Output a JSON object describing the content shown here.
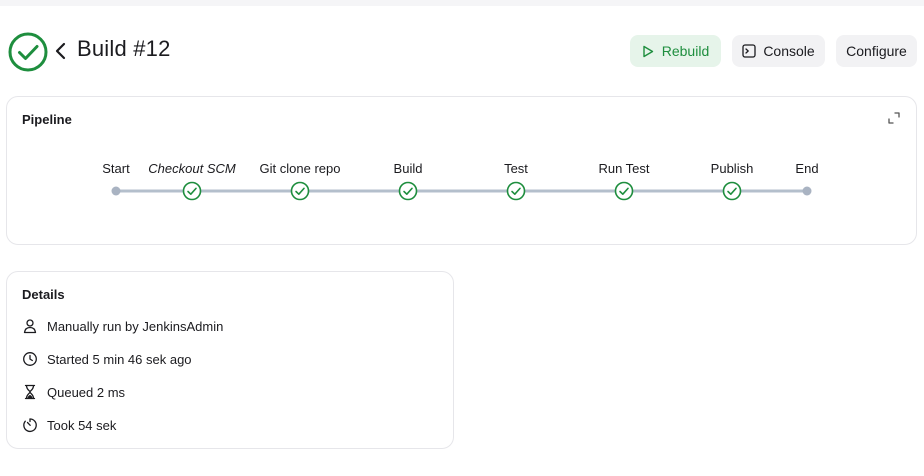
{
  "header": {
    "title": "Build #12",
    "buttons": {
      "rebuild": "Rebuild",
      "console": "Console",
      "configure": "Configure"
    },
    "status": "success"
  },
  "pipeline": {
    "title": "Pipeline",
    "stages": [
      {
        "label": "Start",
        "kind": "start",
        "italic": false
      },
      {
        "label": "Checkout SCM",
        "kind": "success",
        "italic": true
      },
      {
        "label": "Git clone repo",
        "kind": "success",
        "italic": false
      },
      {
        "label": "Build",
        "kind": "success",
        "italic": false
      },
      {
        "label": "Test",
        "kind": "success",
        "italic": false
      },
      {
        "label": "Run Test",
        "kind": "success",
        "italic": false
      },
      {
        "label": "Publish",
        "kind": "success",
        "italic": false
      },
      {
        "label": "End",
        "kind": "end",
        "italic": false
      }
    ]
  },
  "details": {
    "title": "Details",
    "items": [
      {
        "icon": "user-icon",
        "text": "Manually run by JenkinsAdmin"
      },
      {
        "icon": "clock-icon",
        "text": "Started 5 min 46 sek ago"
      },
      {
        "icon": "hourglass-icon",
        "text": "Queued 2 ms"
      },
      {
        "icon": "timer-icon",
        "text": "Took 54 sek"
      }
    ]
  },
  "colors": {
    "success": "#1e8e3e",
    "connector": "#b4bfcc",
    "node_gray": "#a9b3c2"
  }
}
